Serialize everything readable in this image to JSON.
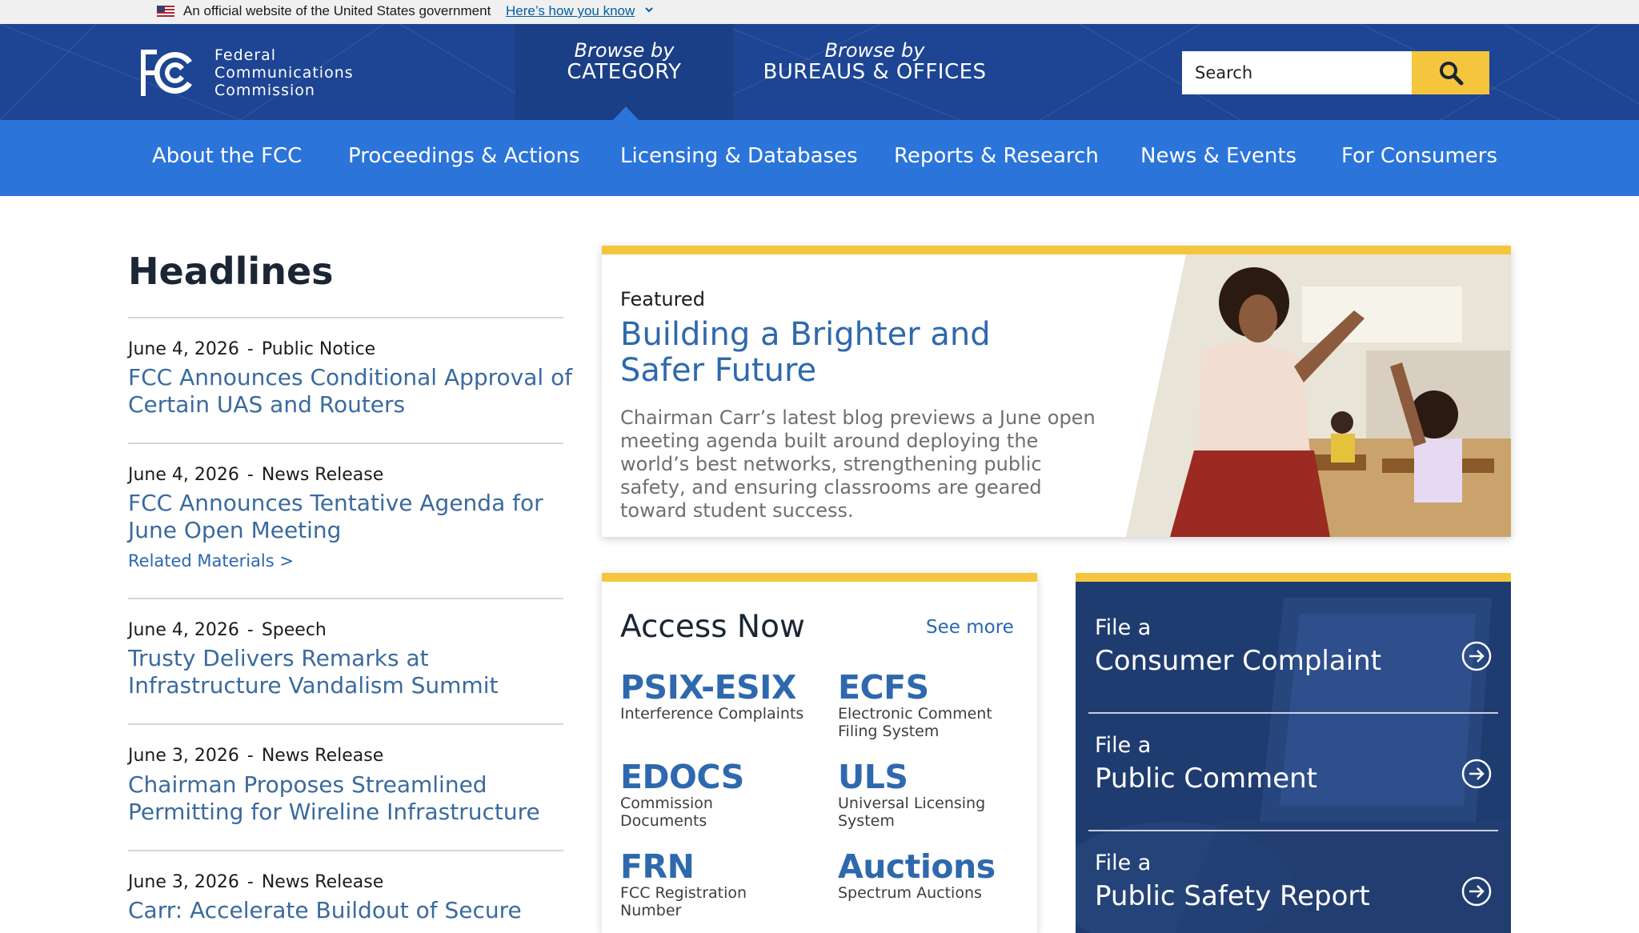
{
  "gov_banner": {
    "text": "An official website of the United States government",
    "link": "Here’s how you know"
  },
  "header": {
    "logo_lines": [
      "Federal",
      "Communications",
      "Commission"
    ],
    "browse_category": {
      "small": "Browse by",
      "big": "CATEGORY"
    },
    "browse_bureaus": {
      "small": "Browse by",
      "big": "BUREAUS & OFFICES"
    },
    "search_placeholder": "Search"
  },
  "nav": {
    "items": [
      "About the FCC",
      "Proceedings & Actions",
      "Licensing & Databases",
      "Reports & Research",
      "News & Events",
      "For Consumers"
    ]
  },
  "headlines": {
    "title": "Headlines",
    "items": [
      {
        "date": "June 4, 2026",
        "sep": "-",
        "type": "Public Notice",
        "title": "FCC Announces Conditional Approval of Certain UAS and Routers"
      },
      {
        "date": "June 4, 2026",
        "sep": "-",
        "type": "News Release",
        "title": "FCC Announces Tentative Agenda for June Open Meeting",
        "related": "Related Materials >"
      },
      {
        "date": "June 4, 2026",
        "sep": "-",
        "type": "Speech",
        "title": "Trusty Delivers Remarks at Infrastructure Vandalism Summit"
      },
      {
        "date": "June 3, 2026",
        "sep": "-",
        "type": "News Release",
        "title": "Chairman Proposes Streamlined Permitting for Wireline Infrastructure"
      },
      {
        "date": "June 3, 2026",
        "sep": "-",
        "type": "News Release",
        "title": "Carr: Accelerate Buildout of Secure"
      }
    ]
  },
  "featured": {
    "kicker": "Featured",
    "title": "Building a Brighter and Safer Future",
    "description": "Chairman Carr’s latest blog previews a June open meeting agenda built around deploying the world’s best networks, strengthening public safety, and ensuring classrooms are geared toward student success."
  },
  "access_now": {
    "title": "Access Now",
    "see_more": "See more",
    "tools": [
      {
        "name": "PSIX-ESIX",
        "desc": "Interference Complaints"
      },
      {
        "name": "ECFS",
        "desc": "Electronic Comment Filing System"
      },
      {
        "name": "EDOCS",
        "desc": "Commission Documents"
      },
      {
        "name": "ULS",
        "desc": "Universal Licensing System"
      },
      {
        "name": "FRN",
        "desc": "FCC Registration Number"
      },
      {
        "name": "Auctions",
        "desc": "Spectrum Auctions"
      }
    ]
  },
  "file_panel": {
    "items": [
      {
        "prefix": "File a",
        "label": "Consumer Complaint"
      },
      {
        "prefix": "File a",
        "label": "Public Comment"
      },
      {
        "prefix": "File a",
        "label": "Public Safety Report"
      }
    ]
  },
  "colors": {
    "header_blue": "#1d4593",
    "nav_blue": "#2b74d9",
    "accent_yellow": "#f5c53e",
    "link_blue": "#2e69ad"
  }
}
